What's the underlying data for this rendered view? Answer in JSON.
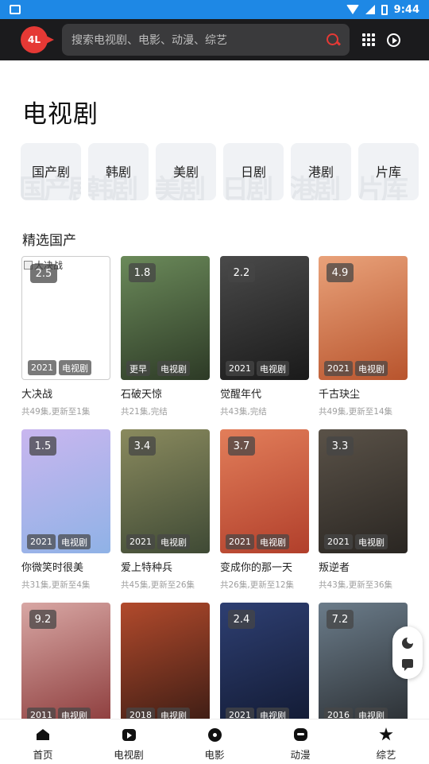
{
  "status_bar": {
    "time": "9:44"
  },
  "header": {
    "logo_text": "4L",
    "search_placeholder": "搜索电视剧、电影、动漫、综艺"
  },
  "page": {
    "title": "电视剧"
  },
  "categories": [
    {
      "label": "国产剧",
      "ghost": "国产剧"
    },
    {
      "label": "韩剧",
      "ghost": "韩剧"
    },
    {
      "label": "美剧",
      "ghost": "美剧"
    },
    {
      "label": "日剧",
      "ghost": "日剧"
    },
    {
      "label": "港剧",
      "ghost": "港剧"
    },
    {
      "label": "片库",
      "ghost": "片库"
    }
  ],
  "section": {
    "title": "精选国产"
  },
  "movies": [
    {
      "title": "大决战",
      "rating": "2.5",
      "year": "2021",
      "type": "电视剧",
      "meta": "共49集,更新至1集",
      "broken_alt": "大决战",
      "colors": [
        "#ffffff",
        "#ffffff"
      ]
    },
    {
      "title": "石破天惊",
      "rating": "1.8",
      "year": "",
      "year_text": "更早",
      "type": "电视剧",
      "meta": "共21集,完结",
      "colors": [
        "#6b8a5a",
        "#2d3a26"
      ]
    },
    {
      "title": "觉醒年代",
      "rating": "2.2",
      "year": "2021",
      "type": "电视剧",
      "meta": "共43集,完结",
      "colors": [
        "#4a4a4a",
        "#1a1a1a"
      ]
    },
    {
      "title": "千古玦尘",
      "rating": "4.9",
      "year": "2021",
      "type": "电视剧",
      "meta": "共49集,更新至14集",
      "colors": [
        "#e9a27a",
        "#b8542d"
      ]
    },
    {
      "title": "你微笑时很美",
      "rating": "1.5",
      "year": "2021",
      "type": "电视剧",
      "meta": "共31集,更新至4集",
      "colors": [
        "#c9b6ef",
        "#8fb2e6"
      ]
    },
    {
      "title": "爱上特种兵",
      "rating": "3.4",
      "year": "2021",
      "type": "电视剧",
      "meta": "共45集,更新至26集",
      "colors": [
        "#8a8a5e",
        "#3f4a35"
      ]
    },
    {
      "title": "变成你的那一天",
      "rating": "3.7",
      "year": "2021",
      "type": "电视剧",
      "meta": "共26集,更新至12集",
      "colors": [
        "#e27e5a",
        "#b13f2b"
      ]
    },
    {
      "title": "叛逆者",
      "rating": "3.3",
      "year": "2021",
      "type": "电视剧",
      "meta": "共43集,更新至36集",
      "colors": [
        "#5a5248",
        "#2a2622"
      ]
    },
    {
      "title": "",
      "rating": "9.2",
      "year": "2011",
      "type": "电视剧",
      "meta": "",
      "colors": [
        "#d8a7a4",
        "#8c3b3b"
      ]
    },
    {
      "title": "",
      "rating": "",
      "year": "2018",
      "type": "电视剧",
      "meta": "",
      "colors": [
        "#b24a2c",
        "#3b1c14"
      ]
    },
    {
      "title": "",
      "rating": "2.4",
      "year": "2021",
      "type": "电视剧",
      "meta": "",
      "colors": [
        "#2e3f72",
        "#121a33"
      ]
    },
    {
      "title": "",
      "rating": "7.2",
      "year": "2016",
      "type": "电视剧",
      "meta": "",
      "colors": [
        "#6b7c8a",
        "#2b2f33"
      ]
    }
  ],
  "bottom_nav": [
    {
      "label": "首页",
      "icon": "home-icon"
    },
    {
      "label": "电视剧",
      "icon": "tv-icon"
    },
    {
      "label": "电影",
      "icon": "film-icon"
    },
    {
      "label": "动漫",
      "icon": "anime-icon"
    },
    {
      "label": "综艺",
      "icon": "star-icon"
    }
  ],
  "colors": {
    "accent": "#e53935",
    "header_bg": "#1b1b1d",
    "status_bar": "#1e88e5"
  }
}
